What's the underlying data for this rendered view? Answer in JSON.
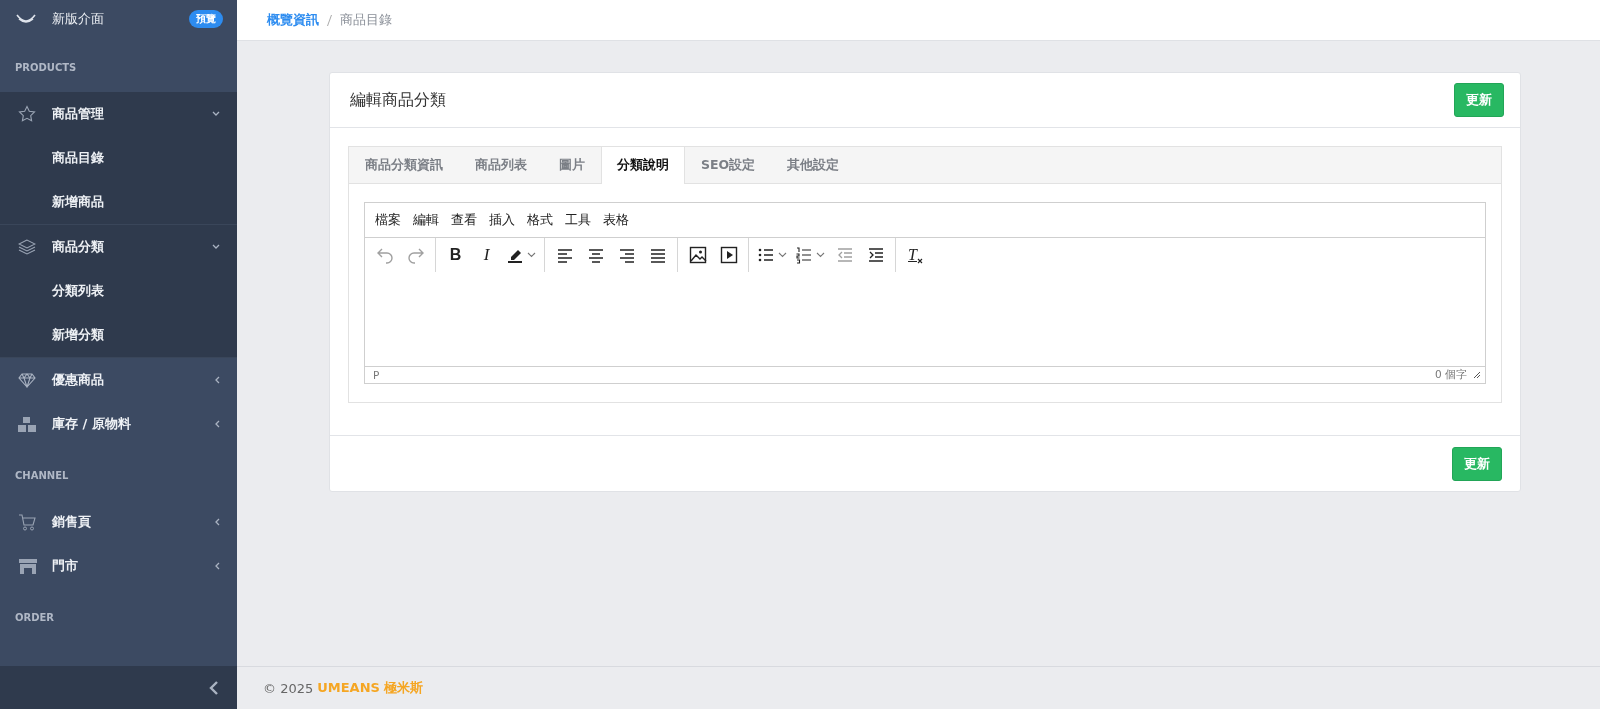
{
  "sidebar": {
    "brand": {
      "label": "新版介面",
      "badge": "預覽"
    },
    "sections": [
      {
        "heading": "PRODUCTS",
        "items": [
          {
            "label": "商品管理",
            "expanded": true,
            "children": [
              {
                "label": "商品目錄"
              },
              {
                "label": "新增商品"
              }
            ]
          },
          {
            "label": "商品分類",
            "expanded": true,
            "children": [
              {
                "label": "分類列表"
              },
              {
                "label": "新增分類"
              }
            ]
          },
          {
            "label": "優惠商品",
            "expanded": false
          },
          {
            "label": "庫存 / 原物料",
            "expanded": false
          }
        ]
      },
      {
        "heading": "CHANNEL",
        "items": [
          {
            "label": "銷售頁",
            "expanded": false
          },
          {
            "label": "門市",
            "expanded": false
          }
        ]
      },
      {
        "heading": "ORDER"
      }
    ]
  },
  "breadcrumb": [
    {
      "label": "概覽資訊",
      "link": true
    },
    {
      "label": "商品目錄",
      "link": false
    }
  ],
  "card": {
    "title": "編輯商品分類",
    "header_button": "更新",
    "footer_button": "更新"
  },
  "tabs": [
    {
      "label": "商品分類資訊",
      "selected": false
    },
    {
      "label": "商品列表",
      "selected": false
    },
    {
      "label": "圖片",
      "selected": false
    },
    {
      "label": "分類說明",
      "selected": true
    },
    {
      "label": "SEO設定",
      "selected": false
    },
    {
      "label": "其他設定",
      "selected": false
    }
  ],
  "editor": {
    "menu": [
      "檔案",
      "編輯",
      "查看",
      "插入",
      "格式",
      "工具",
      "表格"
    ],
    "toolbar": [
      {
        "tools": [
          {
            "kind": "undo",
            "disabled": true
          },
          {
            "kind": "redo",
            "disabled": true
          }
        ]
      },
      {
        "tools": [
          {
            "kind": "bold",
            "glyph": "B",
            "disabled": false
          },
          {
            "kind": "italic",
            "glyph": "I",
            "disabled": false
          },
          {
            "kind": "highlight",
            "dropdown": true,
            "disabled": false
          }
        ]
      },
      {
        "tools": [
          {
            "kind": "alignleft",
            "disabled": false
          },
          {
            "kind": "aligncenter",
            "disabled": false
          },
          {
            "kind": "alignright",
            "disabled": false
          },
          {
            "kind": "justify",
            "disabled": false
          }
        ]
      },
      {
        "tools": [
          {
            "kind": "image",
            "disabled": false
          },
          {
            "kind": "media",
            "disabled": false
          }
        ]
      },
      {
        "tools": [
          {
            "kind": "bullets",
            "dropdown": true,
            "disabled": false
          },
          {
            "kind": "numbers",
            "dropdown": true,
            "disabled": false
          },
          {
            "kind": "outdent",
            "disabled": true
          },
          {
            "kind": "indent",
            "disabled": false
          }
        ]
      },
      {
        "tools": [
          {
            "kind": "clearformat",
            "glyph": "T",
            "disabled": false
          }
        ]
      }
    ],
    "path": "P",
    "word_count": "0 個字"
  },
  "footer": {
    "copyright": "© 2025",
    "brand": "UMEANS 極米斯"
  }
}
